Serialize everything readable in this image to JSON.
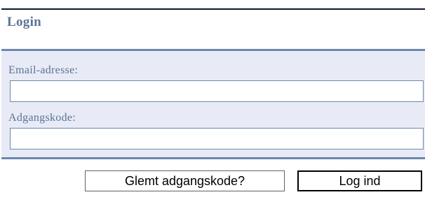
{
  "login": {
    "title": "Login",
    "email_label": "Email-adresse:",
    "email_value": "",
    "password_label": "Adgangskode:",
    "password_value": "",
    "forgot_button": "Glemt adgangskode?",
    "login_button": "Log ind"
  },
  "colors": {
    "header_text": "#5a7396",
    "form_background": "#e8ebf6",
    "separator": "#6c88ad",
    "top_border": "#0b1733"
  }
}
